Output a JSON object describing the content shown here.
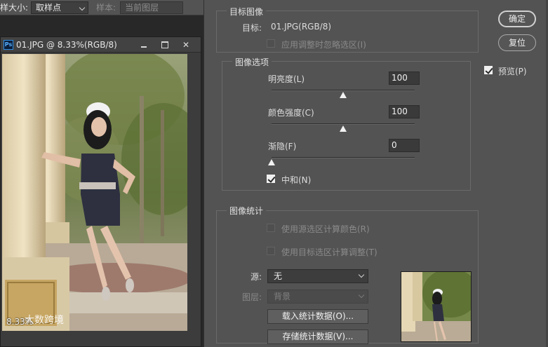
{
  "options_bar": {
    "sample_size_label": "样大小:",
    "sample_size_value": "取样点",
    "sample_label": "样本:",
    "sample_value": "当前图层"
  },
  "document": {
    "title": "01.JPG @ 8.33%(RGB/8)",
    "ps_badge": "Ps",
    "close_glyph": "✕",
    "zoom_text": "8.33%",
    "watermark": "大数跨境"
  },
  "dialog": {
    "target_group": {
      "title": "目标图像",
      "target_label": "目标:",
      "target_value": "01.JPG(RGB/8)",
      "ignore_selection_label": "应用调整时忽略选区(I)",
      "ignore_selection_checked": false
    },
    "image_options": {
      "title": "图像选项",
      "luminance_label": "明亮度(L)",
      "luminance_value": "100",
      "luminance_level": 0.5,
      "color_intensity_label": "颜色强度(C)",
      "color_intensity_value": "100",
      "color_intensity_level": 0.5,
      "fade_label": "渐隐(F)",
      "fade_value": "0",
      "fade_level": 0.0,
      "neutralize_label": "中和(N)",
      "neutralize_checked": true
    },
    "statistics": {
      "title": "图像统计",
      "use_source_selection_label": "使用源选区计算颜色(R)",
      "use_target_selection_label": "使用目标选区计算调整(T)",
      "source_label": "源:",
      "source_value": "无",
      "layer_label": "图层:",
      "layer_value": "背景",
      "load_stats_button": "载入统计数据(O)...",
      "save_stats_button": "存储统计数据(V)..."
    },
    "buttons": {
      "ok": "确定",
      "reset": "复位",
      "preview_label": "预览(P)",
      "preview_checked": true
    }
  },
  "colors": {
    "panel_bg": "#535353",
    "workspace_bg": "#282828",
    "accent_white": "#f0f0f0"
  }
}
